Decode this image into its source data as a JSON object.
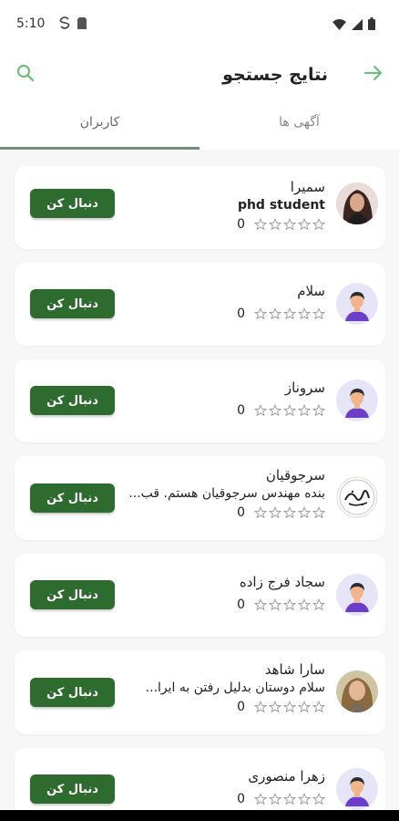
{
  "status": {
    "time": "5:10",
    "icons": [
      "app-s-icon",
      "sim-card-icon",
      "wifi-icon",
      "signal-icon",
      "battery-icon"
    ]
  },
  "app_bar": {
    "title": "نتایج جستجو",
    "icons": {
      "back": "arrow-right-icon",
      "search": "search-icon"
    },
    "accent": "#6fbf7a"
  },
  "tabs": [
    {
      "label": "آگهی ها",
      "active": false
    },
    {
      "label": "کاربران",
      "active": true
    }
  ],
  "users": [
    {
      "name": "سمیرا",
      "bio": "phd student",
      "rating": "0",
      "avatar": "photo-woman",
      "button": "دنبال کن"
    },
    {
      "name": "سلام",
      "bio": "",
      "rating": "0",
      "avatar": "default-user",
      "button": "دنبال کن"
    },
    {
      "name": "سروناز",
      "bio": "",
      "rating": "0",
      "avatar": "default-user",
      "button": "دنبال کن"
    },
    {
      "name": "سرجوقیان",
      "bio": "بنده مهندس سرجوقیان هستم. قب...",
      "rating": "0",
      "avatar": "calligraphy-logo",
      "button": "دنبال کن"
    },
    {
      "name": "سجاد فرج زاده",
      "bio": "",
      "rating": "0",
      "avatar": "default-user",
      "button": "دنبال کن"
    },
    {
      "name": "سارا شاهد",
      "bio": "سلام دوستان بدلیل رفتن به ایرا...",
      "rating": "0",
      "avatar": "photo-woman-2",
      "button": "دنبال کن"
    },
    {
      "name": "زهرا منصوری",
      "bio": "",
      "rating": "0",
      "avatar": "default-user",
      "button": "دنبال کن"
    }
  ],
  "colors": {
    "button": "#2e6b2e",
    "tab_indicator": "#6f8f76",
    "background": "#f7f7f7"
  }
}
